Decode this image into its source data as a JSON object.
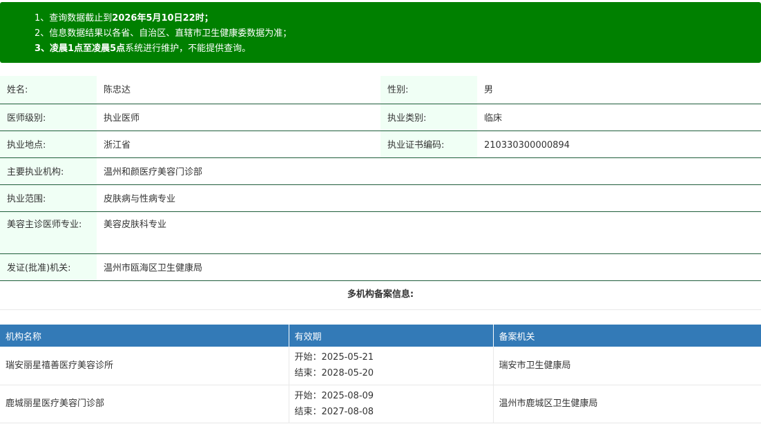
{
  "notice": {
    "line1_prefix": "1、查询数据截止到",
    "line1_bold": "2026年5月10日22时；",
    "line2": "2、信息数据结果以各省、自治区、直辖市卫生健康委数据为准；",
    "line3_prefix": "3、",
    "line3_bold": "凌晨1点至凌晨5点",
    "line3_suffix": "系统进行维护，不能提供查询。"
  },
  "info": {
    "name_label": "姓名:",
    "name": "陈忠达",
    "gender_label": "性别:",
    "gender": "男",
    "level_label": "医师级别:",
    "level": "执业医师",
    "category_label": "执业类别:",
    "category": "临床",
    "location_label": "执业地点:",
    "location": "浙江省",
    "cert_label": "执业证书编码:",
    "cert": "210330300000894",
    "org_label": "主要执业机构:",
    "org": "温州和颜医疗美容门诊部",
    "scope_label": "执业范围:",
    "scope": "皮肤病与性病专业",
    "beauty_label": "美容主诊医师专业:",
    "beauty": "美容皮肤科专业",
    "issuer_label": "发证(批准)机关:",
    "issuer": "温州市瓯海区卫生健康局"
  },
  "multi_title": "多机构备案信息:",
  "records": {
    "headers": [
      "机构名称",
      "有效期",
      "备案机关"
    ],
    "rows": [
      {
        "org": "瑞安丽星禧善医疗美容诊所",
        "start": "开始：2025-05-21",
        "end": "结束：2028-05-20",
        "authority": "瑞安市卫生健康局"
      },
      {
        "org": "鹿城丽星医疗美容门诊部",
        "start": "开始：2025-08-09",
        "end": "结束：2027-08-08",
        "authority": "温州市鹿城区卫生健康局"
      }
    ]
  }
}
